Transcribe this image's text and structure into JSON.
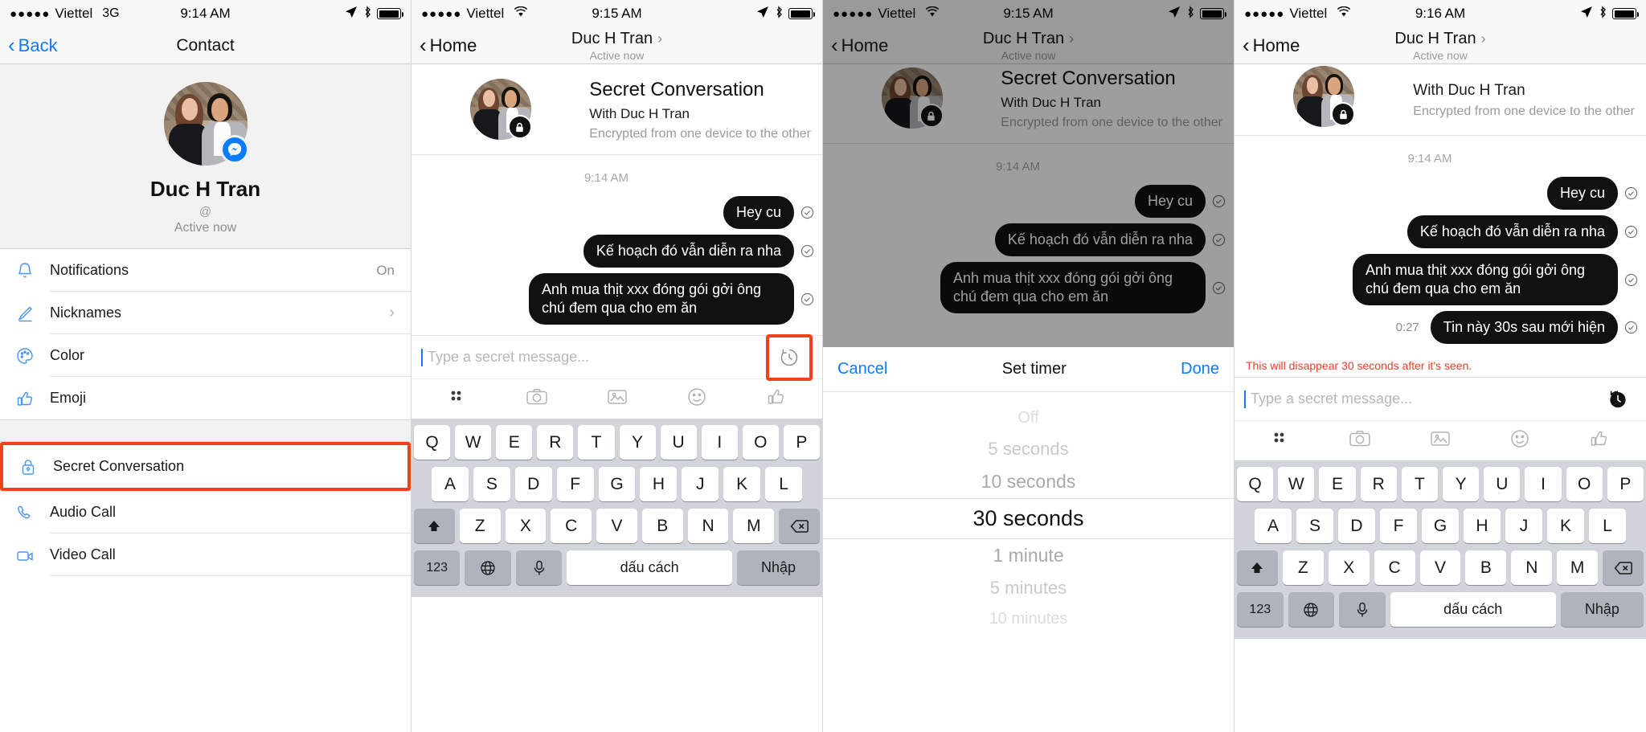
{
  "panels": [
    {
      "id": "contact-profile",
      "status": {
        "carrier": "Viettel",
        "network": "3G",
        "time": "9:14 AM"
      },
      "nav": {
        "back": "Back",
        "title": "Contact"
      },
      "profile": {
        "name": "Duc H Tran",
        "handle": "@",
        "status": "Active now"
      },
      "menu_group_1": [
        {
          "icon": "bell-icon",
          "label": "Notifications",
          "value": "On"
        },
        {
          "icon": "pencil-icon",
          "label": "Nicknames",
          "value": "›"
        },
        {
          "icon": "palette-icon",
          "label": "Color",
          "value": ""
        },
        {
          "icon": "thumbs-up-icon",
          "label": "Emoji",
          "value": ""
        }
      ],
      "menu_group_2": [
        {
          "icon": "lock-icon",
          "label": "Secret Conversation",
          "highlighted": true
        },
        {
          "icon": "phone-icon",
          "label": "Audio Call"
        },
        {
          "icon": "video-icon",
          "label": "Video Call"
        }
      ]
    },
    {
      "id": "secret-conversation-compose",
      "status": {
        "carrier": "Viettel",
        "network": "wifi",
        "time": "9:15 AM"
      },
      "nav": {
        "back": "Home",
        "title": "Duc H Tran",
        "subtitle": "Active now"
      },
      "chat_header": {
        "title": "Secret Conversation",
        "with": "With Duc H Tran",
        "note": "Encrypted from one device to the other"
      },
      "timestamp": "9:14 AM",
      "messages": [
        {
          "text": "Hey cu",
          "sent": true
        },
        {
          "text": "Kế hoạch đó vẫn diễn ra nha",
          "sent": true
        },
        {
          "text": "Anh mua thịt xxx đóng gói gởi ông chú đem qua cho em ăn",
          "sent": true
        }
      ],
      "input": {
        "placeholder": "Type a secret message...",
        "timer_icon": "timer-icon",
        "timer_highlighted": true
      },
      "toolbar": [
        "apps-icon",
        "camera-icon",
        "photos-icon",
        "sticker-icon",
        "thumbs-up-icon"
      ],
      "keyboard": {
        "row1": [
          "Q",
          "W",
          "E",
          "R",
          "T",
          "Y",
          "U",
          "I",
          "O",
          "P"
        ],
        "row2": [
          "A",
          "S",
          "D",
          "F",
          "G",
          "H",
          "J",
          "K",
          "L"
        ],
        "row3": [
          "Z",
          "X",
          "C",
          "V",
          "B",
          "N",
          "M"
        ],
        "shift": "shift-icon",
        "backspace": "backspace-icon",
        "numbers": "123",
        "globe": "globe-icon",
        "mic": "mic-icon",
        "space": "dấu cách",
        "enter": "Nhập"
      }
    },
    {
      "id": "set-timer-picker",
      "status": {
        "carrier": "Viettel",
        "network": "wifi",
        "time": "9:15 AM"
      },
      "nav": {
        "back": "Home",
        "title": "Duc H Tran",
        "subtitle": "Active now"
      },
      "chat_header": {
        "title": "Secret Conversation",
        "with": "With Duc H Tran",
        "note": "Encrypted from one device to the other"
      },
      "timestamp": "9:14 AM",
      "messages": [
        {
          "text": "Hey cu",
          "sent": true
        },
        {
          "text": "Kế hoạch đó vẫn diễn ra nha",
          "sent": true
        },
        {
          "text": "Anh mua thịt xxx đóng gói gởi ông chú đem qua cho em ăn",
          "sent": true
        }
      ],
      "picker": {
        "cancel": "Cancel",
        "title": "Set timer",
        "done": "Done",
        "options": [
          "Off",
          "5 seconds",
          "10 seconds",
          "30 seconds",
          "1 minute",
          "5 minutes",
          "10 minutes"
        ],
        "selected": "30 seconds"
      }
    },
    {
      "id": "secret-conversation-sent",
      "status": {
        "carrier": "Viettel",
        "network": "wifi",
        "time": "9:16 AM"
      },
      "nav": {
        "back": "Home",
        "title": "Duc H Tran",
        "subtitle": "Active now"
      },
      "chat_header": {
        "with": "With Duc H Tran",
        "note": "Encrypted from one device to the other"
      },
      "timestamp": "9:14 AM",
      "messages": [
        {
          "text": "Hey cu",
          "sent": true
        },
        {
          "text": "Kế hoạch đó vẫn diễn ra nha",
          "sent": true
        },
        {
          "text": "Anh mua thịt xxx đóng gói gởi ông chú đem qua cho em ăn",
          "sent": true
        },
        {
          "text": "Tin này 30s sau mới hiện",
          "sent": true,
          "countdown": "0:27"
        }
      ],
      "disappear_notice": "This will disappear 30 seconds after it's seen.",
      "input": {
        "placeholder": "Type a secret message...",
        "timer_icon": "timer-filled-icon"
      },
      "toolbar": [
        "apps-icon",
        "camera-icon",
        "photos-icon",
        "sticker-icon",
        "thumbs-up-icon"
      ],
      "keyboard": {
        "row1": [
          "Q",
          "W",
          "E",
          "R",
          "T",
          "Y",
          "U",
          "I",
          "O",
          "P"
        ],
        "row2": [
          "A",
          "S",
          "D",
          "F",
          "G",
          "H",
          "J",
          "K",
          "L"
        ],
        "row3": [
          "Z",
          "X",
          "C",
          "V",
          "B",
          "N",
          "M"
        ],
        "shift": "shift-icon",
        "backspace": "backspace-icon",
        "numbers": "123",
        "globe": "globe-icon",
        "mic": "mic-icon",
        "space": "dấu cách",
        "enter": "Nhập"
      }
    }
  ],
  "colors": {
    "accent": "#0a7cff",
    "highlight": "#f0411a",
    "bubble": "#111111",
    "warn": "#e8402a"
  }
}
